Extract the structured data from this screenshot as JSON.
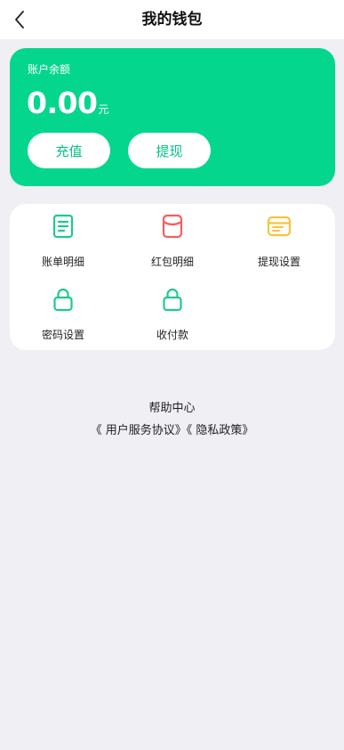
{
  "header": {
    "title": "我的钱包",
    "back_icon": "chevron-left-icon"
  },
  "balance_card": {
    "label": "账户余额",
    "amount": "0.00",
    "unit": "元",
    "background_color": "#05d68e",
    "recharge_label": "充值",
    "withdraw_label": "提现"
  },
  "menu": {
    "items": [
      {
        "label": "账单明细",
        "icon": "bill-document-icon",
        "color": "#1fc98f"
      },
      {
        "label": "红包明细",
        "icon": "red-envelope-icon",
        "color": "#f0605f"
      },
      {
        "label": "提现设置",
        "icon": "card-icon",
        "color": "#f9c33b"
      },
      {
        "label": "密码设置",
        "icon": "lock-icon",
        "color": "#1fc98f"
      },
      {
        "label": "收付款",
        "icon": "lock-icon",
        "color": "#1fc98f"
      }
    ]
  },
  "footer": {
    "help_center": "帮助中心",
    "user_agreement": "《 用户服务协议》",
    "privacy_policy": "《 隐私政策》"
  }
}
